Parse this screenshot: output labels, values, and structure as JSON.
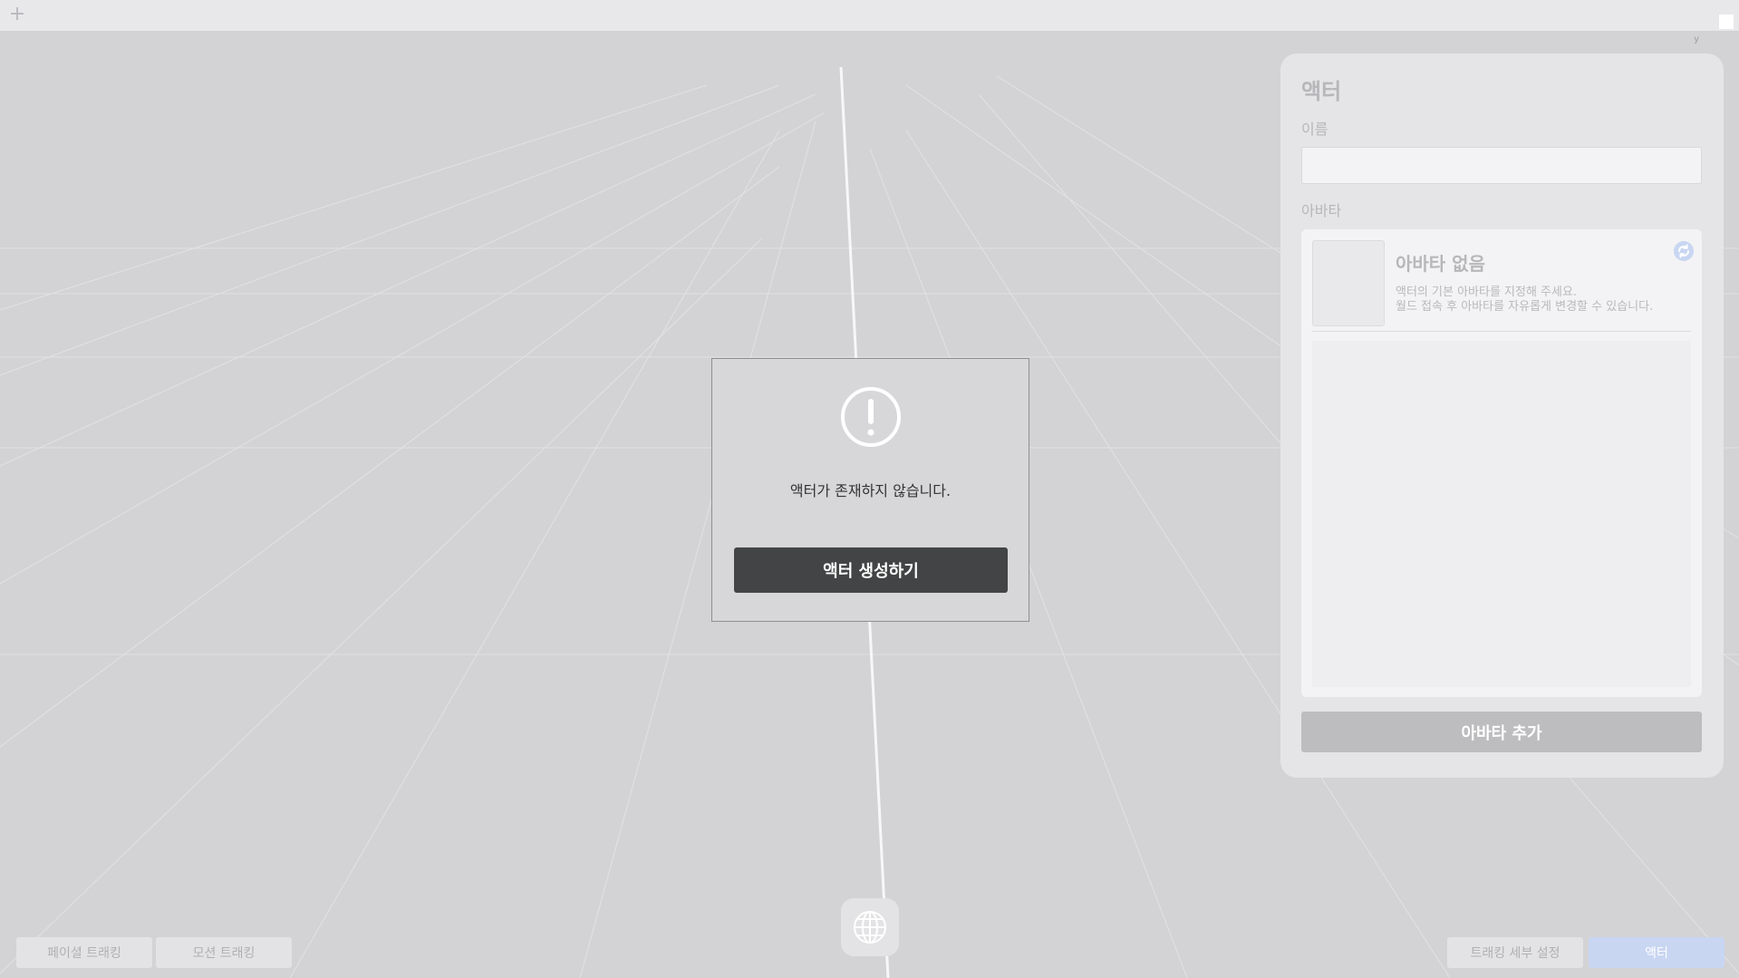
{
  "topbar": {
    "new_icon": "plus-icon"
  },
  "viewport": {
    "axis_label": "y"
  },
  "modal": {
    "icon": "exclamation-circle-icon",
    "message": "액터가 존재하지 않습니다.",
    "create_button": "액터 생성하기"
  },
  "panel": {
    "title": "액터",
    "name_label": "이름",
    "name_value": "",
    "avatar_label": "아바타",
    "avatar": {
      "none_title": "아바타 없음",
      "desc_line1": "액터의 기본 아바타를 지정해 주세요.",
      "desc_line2": "월드 접속 후 아바타를 자유롭게 변경할 수 있습니다.",
      "refresh_icon": "refresh-icon"
    },
    "add_avatar_button": "아바타 추가"
  },
  "bottom": {
    "facial_tracking": "페이셜 트래킹",
    "motion_tracking": "모션 트래킹",
    "tracking_settings": "트래킹 세부 설정",
    "actor": "액터",
    "globe_icon": "globe-icon"
  },
  "colors": {
    "background": "#d3d3d5",
    "panel": "#e5e5e7",
    "primary_button": "#434445",
    "active_tab": "#c9d6f2"
  }
}
